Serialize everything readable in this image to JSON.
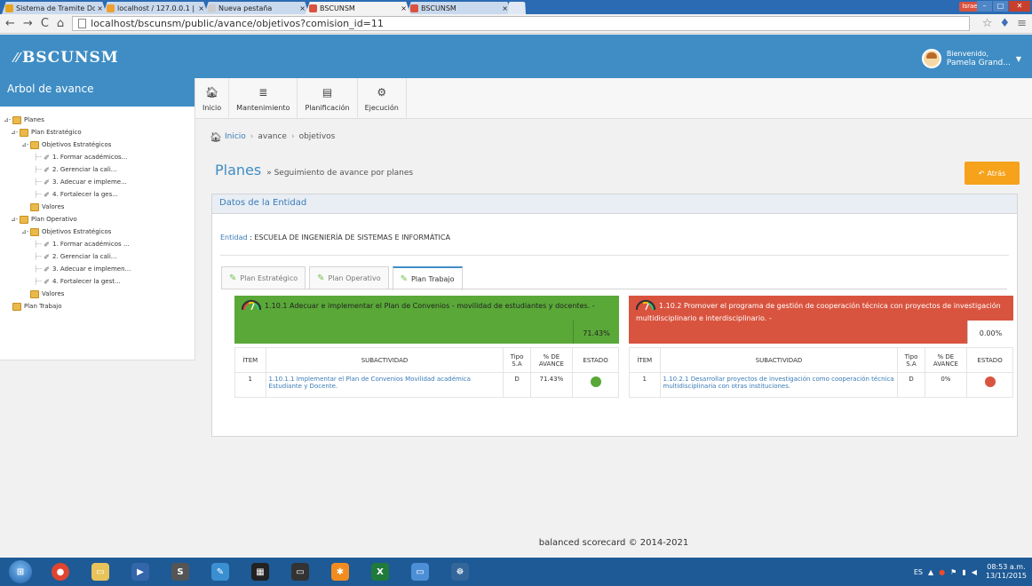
{
  "browser": {
    "tabs": [
      {
        "title": "Sistema de Tramite Docu",
        "favicon_color": "#e7a41c"
      },
      {
        "title": "localhost / 127.0.0.1 | php",
        "favicon_color": "#f0a030"
      },
      {
        "title": "Nueva pestaña",
        "favicon_color": "#cccccc"
      },
      {
        "title": "BSCUNSM",
        "favicon_color": "#d9533f"
      },
      {
        "title": "BSCUNSM",
        "favicon_color": "#d9533f"
      }
    ],
    "user_chip": "Israel",
    "url": "localhost/bscunsm/public/avance/objetivos?comision_id=11"
  },
  "header": {
    "logo": "BSCUNSM",
    "welcome": "Bienvenido,",
    "user_name": "Pamela Grand..."
  },
  "sidebar": {
    "title": "Arbol de avance",
    "tree": [
      {
        "level": 0,
        "kind": "folder",
        "label": "Planes",
        "exp": "⊿-"
      },
      {
        "level": 1,
        "kind": "folder",
        "label": "Plan Estratégico",
        "exp": "⊿-"
      },
      {
        "level": 2,
        "kind": "folder",
        "label": "Objetivos Estratégicos",
        "exp": "⊿-"
      },
      {
        "level": 3,
        "kind": "leaf",
        "label": "1. Formar académicos..."
      },
      {
        "level": 3,
        "kind": "leaf",
        "label": "2. Gerenciar la cali..."
      },
      {
        "level": 3,
        "kind": "leaf",
        "label": "3. Adecuar e impleme..."
      },
      {
        "level": 3,
        "kind": "leaf",
        "label": "4. Fortalecer la ges..."
      },
      {
        "level": 2,
        "kind": "folder",
        "label": "Valores",
        "exp": ""
      },
      {
        "level": 1,
        "kind": "folder",
        "label": "Plan Operativo",
        "exp": "⊿-"
      },
      {
        "level": 2,
        "kind": "folder",
        "label": "Objetivos Estratégicos",
        "exp": "⊿-"
      },
      {
        "level": 3,
        "kind": "leaf",
        "label": "1. Formar académicos ..."
      },
      {
        "level": 3,
        "kind": "leaf",
        "label": "2. Gerenciar la cali..."
      },
      {
        "level": 3,
        "kind": "leaf",
        "label": "3. Adecuar e implemen..."
      },
      {
        "level": 3,
        "kind": "leaf",
        "label": "4. Fortalecer la gest..."
      },
      {
        "level": 2,
        "kind": "folder",
        "label": "Valores",
        "exp": ""
      },
      {
        "level": 0,
        "kind": "folder",
        "label": "Plan Trabajo",
        "exp": ""
      }
    ]
  },
  "topmenu": [
    {
      "label": "Inicio",
      "icon": "home-icon",
      "glyph": "🏠︎"
    },
    {
      "label": "Mantenimiento",
      "icon": "database-icon",
      "glyph": "≣"
    },
    {
      "label": "Planificación",
      "icon": "briefcase-icon",
      "glyph": "▤"
    },
    {
      "label": "Ejecución",
      "icon": "gears-icon",
      "glyph": "⚙"
    }
  ],
  "breadcrumb": {
    "home": "Inicio",
    "b2": "avance",
    "b3": "objetivos"
  },
  "page": {
    "title": "Planes",
    "subtitle": "» Seguimiento de avance por planes",
    "back_label": "Atrás"
  },
  "panel": {
    "title": "Datos de la Entidad",
    "entidad_label": "Entidad",
    "entidad_value": ": ESCUELA DE INGENIERÍA DE SISTEMAS E INFORMÁTICA",
    "tabs": [
      "Plan Estratégico",
      "Plan Operativo",
      "Plan Trabajo"
    ]
  },
  "cards": [
    {
      "title": "1.10.1 Adecuar e implementar el Plan de Convenios - movilidad de estudiantes y docentes. -",
      "percent": "71.43%",
      "header_color": "#5aa838",
      "columns": [
        "ÍTEM",
        "SUBACTIVIDAD",
        "Tipo S.A",
        "% DE AVANCE",
        "ESTADO"
      ],
      "rows": [
        {
          "item": "1",
          "sub": "1.10.1.1 Implementar el Plan de Convenios Movilidad académica Estudiante y Docente.",
          "tipo": "D",
          "avance": "71.43%",
          "estado_color": "#5aa838"
        }
      ]
    },
    {
      "title": "1.10.2 Promover el programa de gestión de cooperación técnica con proyectos de investigación multidisciplinario e interdisciplinario. -",
      "percent": "0.00%",
      "header_color": "#d9543f",
      "columns": [
        "ÍTEM",
        "SUBACTIVIDAD",
        "Tipo S.A",
        "% DE AVANCE",
        "ESTADO"
      ],
      "rows": [
        {
          "item": "1",
          "sub": "1.10.2.1 Desarrollar proyectos de investigación como cooperación técnica multidisciplinaria con otras instituciones.",
          "tipo": "D",
          "avance": "0%",
          "estado_color": "#d9543f"
        }
      ]
    }
  ],
  "footer": "balanced scorecard © 2014-2021",
  "taskbar": {
    "lang": "ES",
    "time": "08:53 a.m.",
    "date": "13/11/2015"
  }
}
